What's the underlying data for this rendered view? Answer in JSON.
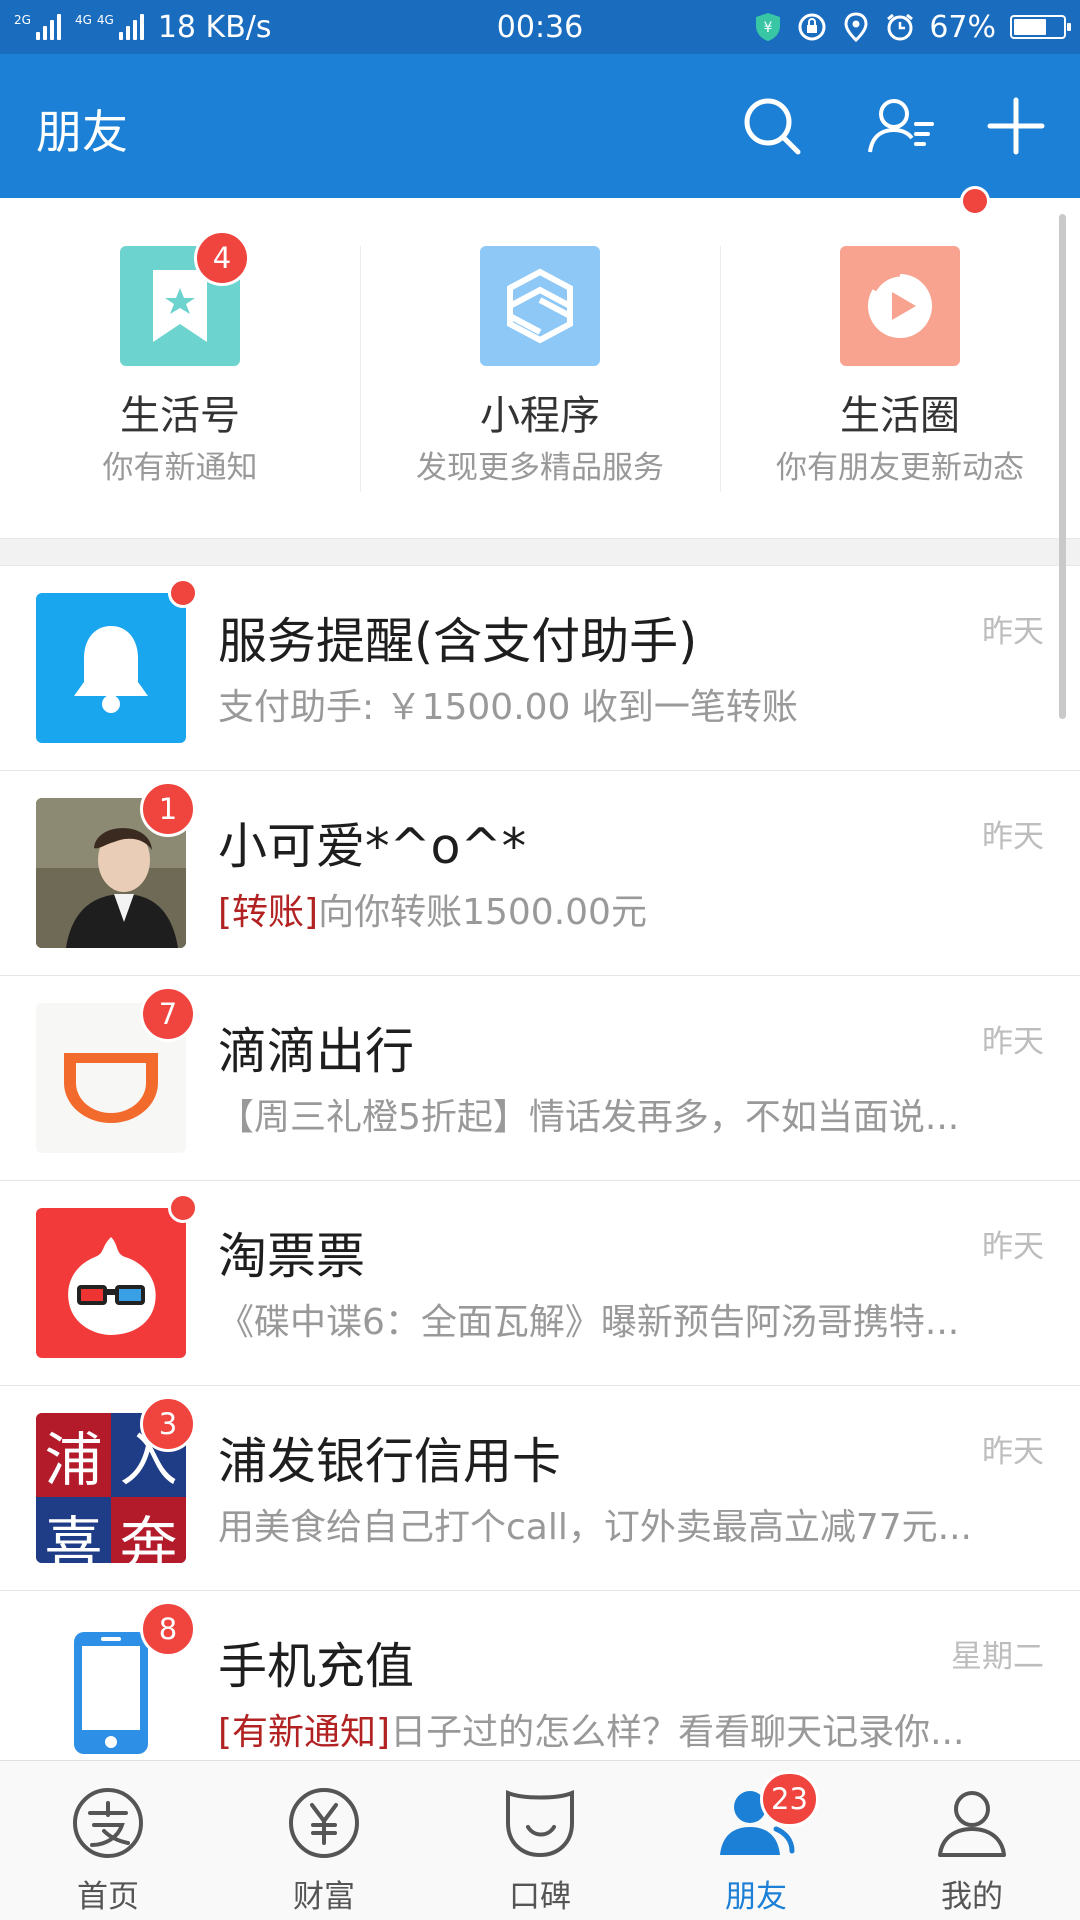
{
  "status_bar": {
    "net_type_1": "2G",
    "net_type_2": "4G",
    "net_type_3": "4G",
    "speed": "18 KB/s",
    "time": "00:36",
    "battery_text": "67%",
    "battery_level": 0.67,
    "icons": [
      "yen-shield-icon",
      "lock-rotate-icon",
      "location-icon",
      "alarm-icon",
      "battery-icon"
    ]
  },
  "header": {
    "title": "朋友",
    "actions": [
      "search-icon",
      "contacts-icon",
      "add-icon"
    ]
  },
  "quick_entries": [
    {
      "title": "生活号",
      "subtitle": "你有新通知",
      "badge": "4",
      "color": "#6dd3cf"
    },
    {
      "title": "小程序",
      "subtitle": "发现更多精品服务",
      "badge": "",
      "color": "#8ec8f6"
    },
    {
      "title": "生活圈",
      "subtitle": "你有朋友更新动态",
      "badge": "dot",
      "color": "#f7a38f"
    }
  ],
  "conversations": [
    {
      "title": "服务提醒(含支付助手)",
      "tag": "",
      "message": "支付助手: ￥1500.00 收到一笔转账",
      "time": "昨天",
      "badge": "dot",
      "avatar": "bell-icon",
      "avatar_color": "#1aa6ef"
    },
    {
      "title": "小可爱*^o^*",
      "tag": "[转账]",
      "message": "向你转账1500.00元",
      "time": "昨天",
      "badge": "1",
      "avatar": "user-photo",
      "avatar_color": "#5c5a48"
    },
    {
      "title": "滴滴出行",
      "tag": "",
      "message": "【周三礼橙5折起】情话发再多，不如当面说...",
      "time": "昨天",
      "badge": "7",
      "avatar": "didi-logo-icon",
      "avatar_color": "#f7f7f5"
    },
    {
      "title": "淘票票",
      "tag": "",
      "message": "《碟中谍6：全面瓦解》曝新预告阿汤哥携特...",
      "time": "昨天",
      "badge": "dot",
      "avatar": "taopiaopiao-logo-icon",
      "avatar_color": "#f23a3a"
    },
    {
      "title": "浦发银行信用卡",
      "tag": "",
      "message": "用美食给自己打个call，订外卖最高立减77元...",
      "time": "昨天",
      "badge": "3",
      "avatar": "spdb-card-image",
      "avatar_color": "#1f3c87",
      "avatar_text": [
        "浦",
        "入",
        "喜",
        "奔"
      ]
    },
    {
      "title": "手机充值",
      "tag": "[有新通知]",
      "message": "日子过的怎么样？看看聊天记录你...",
      "time": "星期二",
      "badge": "8",
      "avatar": "phone-icon",
      "avatar_color": "#ffffff"
    }
  ],
  "tab_bar": {
    "items": [
      {
        "label": "首页",
        "icon": "alipay-icon",
        "badge": ""
      },
      {
        "label": "财富",
        "icon": "yen-circle-icon",
        "badge": ""
      },
      {
        "label": "口碑",
        "icon": "koubei-icon",
        "badge": ""
      },
      {
        "label": "朋友",
        "icon": "friends-icon",
        "badge": "23",
        "active": true
      },
      {
        "label": "我的",
        "icon": "profile-icon",
        "badge": ""
      }
    ]
  },
  "colors": {
    "status_bg": "#1a6cbf",
    "header_bg": "#1c80d6",
    "badge": "#f0443e",
    "tag_red": "#b22222",
    "active_tab": "#1c80d6"
  }
}
